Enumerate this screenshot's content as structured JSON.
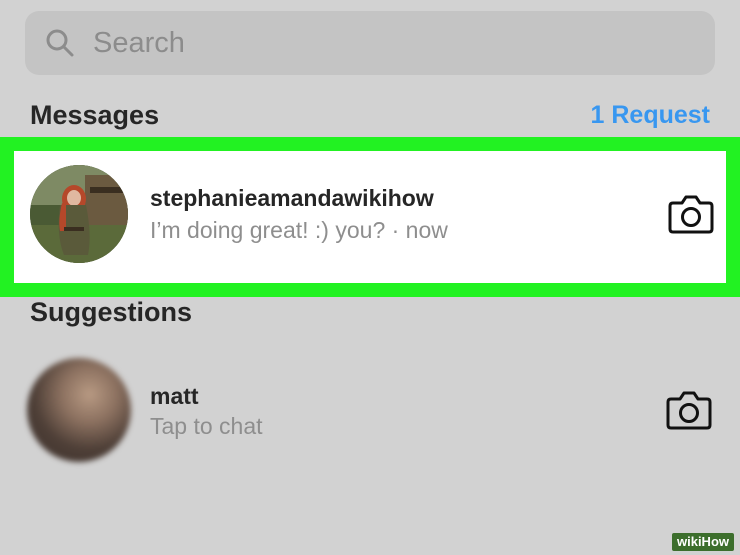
{
  "search": {
    "placeholder": "Search"
  },
  "messages": {
    "title": "Messages",
    "request_link": "1 Request",
    "threads": [
      {
        "username": "stephanieamandawikihow",
        "preview": "I’m doing great! :) you? · now"
      }
    ]
  },
  "suggestions": {
    "title": "Suggestions",
    "items": [
      {
        "username": "matt",
        "subtext": "Tap to chat"
      }
    ]
  },
  "watermark": {
    "text": "wikiHow"
  },
  "colors": {
    "background": "#d2d2d2",
    "highlight": "#22f222",
    "link": "#3897f0",
    "primary_text": "#262626",
    "secondary_text": "#8e8e8e"
  },
  "icons": [
    "search-icon",
    "camera-icon"
  ]
}
